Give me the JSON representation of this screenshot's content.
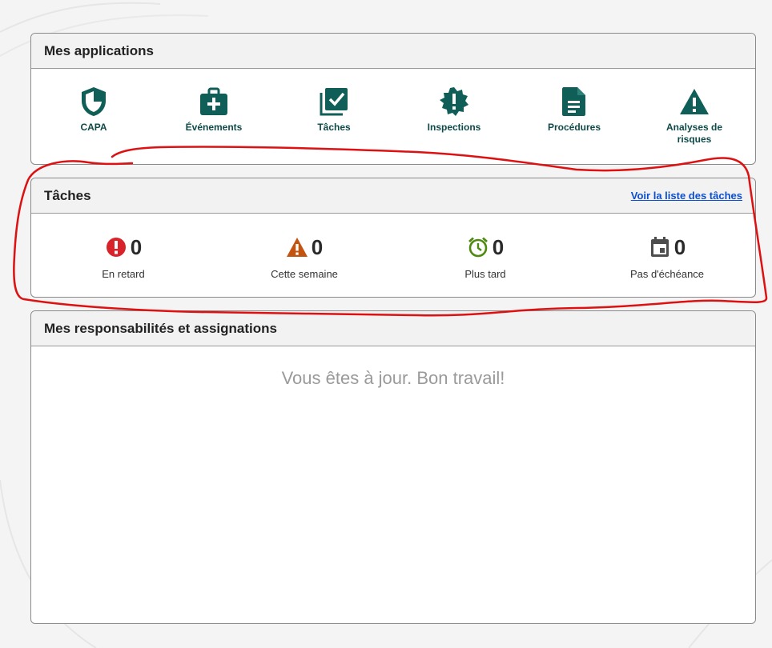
{
  "apps_card": {
    "title": "Mes applications",
    "items": [
      {
        "label": "CAPA",
        "icon": "shield-icon"
      },
      {
        "label": "Événements",
        "icon": "medical-bag-icon"
      },
      {
        "label": "Tâches",
        "icon": "checklist-icon"
      },
      {
        "label": "Inspections",
        "icon": "alert-badge-icon"
      },
      {
        "label": "Procédures",
        "icon": "document-icon"
      },
      {
        "label": "Analyses de risques",
        "icon": "warning-triangle-icon"
      }
    ],
    "icon_color": "#0f5e57"
  },
  "tasks_card": {
    "title": "Tâches",
    "link": "Voir la liste des tâches",
    "stats": [
      {
        "count": "0",
        "label": "En retard",
        "icon": "alert-circle-icon",
        "color": "#d9232a"
      },
      {
        "count": "0",
        "label": "Cette semaine",
        "icon": "warning-icon",
        "color": "#c25410"
      },
      {
        "count": "0",
        "label": "Plus tard",
        "icon": "alarm-clock-icon",
        "color": "#4f8a10"
      },
      {
        "count": "0",
        "label": "Pas d'échéance",
        "icon": "calendar-icon",
        "color": "#4d4d4d"
      }
    ]
  },
  "resp_card": {
    "title": "Mes responsabilités et assignations",
    "empty_message": "Vous êtes à jour. Bon travail!"
  },
  "annotation_color": "#dd1111"
}
